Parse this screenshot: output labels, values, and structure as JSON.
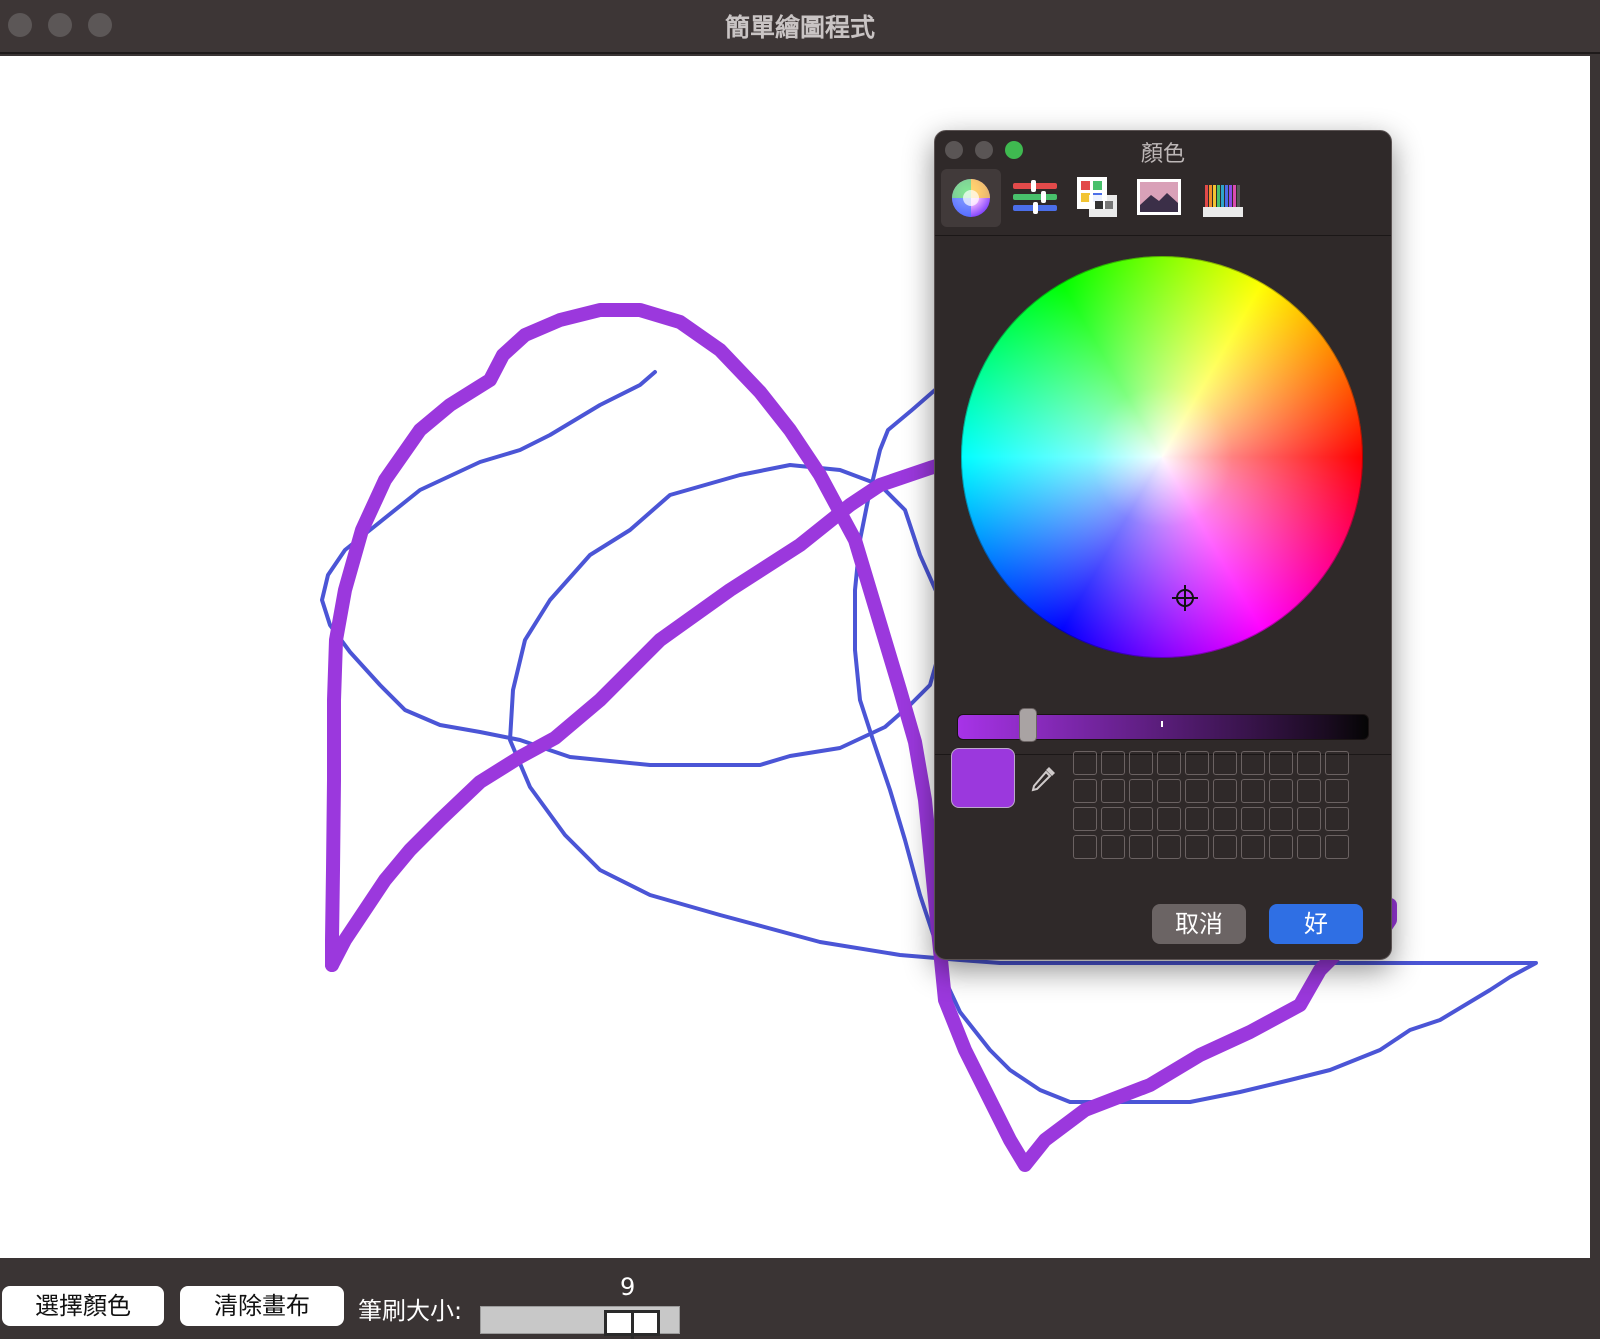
{
  "window": {
    "title": "簡單繪圖程式"
  },
  "toolbar": {
    "choose_color_label": "選擇顏色",
    "clear_canvas_label": "清除畫布",
    "brush_size_label": "筆刷大小:",
    "brush_size_value": "9"
  },
  "color_panel": {
    "title": "顏色",
    "tabs": [
      "color-wheel",
      "color-sliders",
      "color-palettes",
      "image-palettes",
      "pencils"
    ],
    "active_tab": "color-wheel",
    "current_color": "#9b38dd",
    "cancel_label": "取消",
    "ok_label": "好"
  },
  "colors": {
    "stroke_purple": "#9b38dd",
    "stroke_blue": "#4b55d6",
    "ok_blue": "#2f6fe4"
  }
}
